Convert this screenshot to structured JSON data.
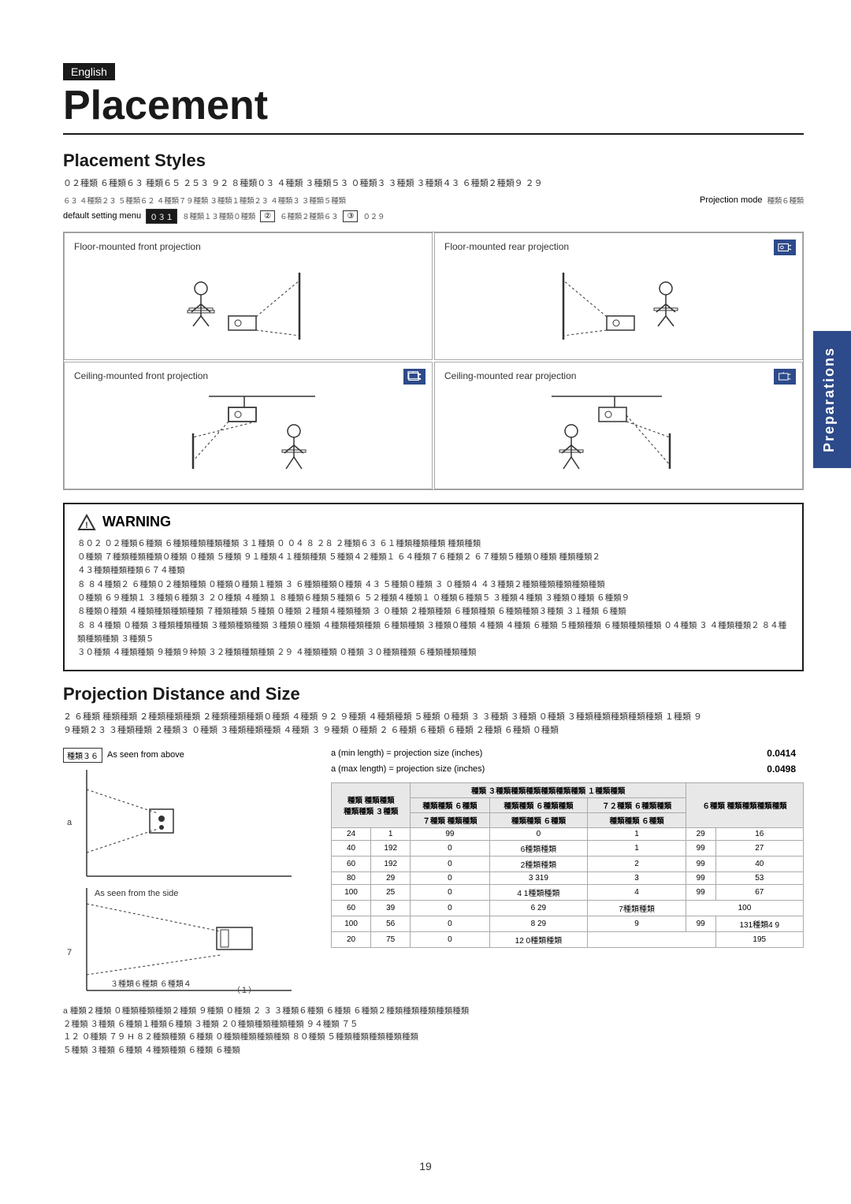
{
  "page": {
    "number": "19",
    "side_tab": "Preparations",
    "english_badge": "English",
    "title": "Placement"
  },
  "placement_styles": {
    "section_title": "Placement Styles",
    "intro_line1": "０２種類 ６種類６３ 種類６５ ２５３ ９２ ８種類０３ ４種類 ３種類５３ ０種類３ ３種類 ３種類４３ ６種類２種類９ ２９",
    "intro_line2": "６３ ４種類２３ ５種類６２ ４種類７９種類 ３種類１種類２３ ４種類３ ３種類５種類",
    "projection_mode_label": "Projection mode",
    "projection_mode_garbled": "種類６種類",
    "default_setting_label": "default setting menu",
    "default_code1": "０３１",
    "default_code2": "８種類１３種類０種類",
    "default_code3": "２種類６種類２種類６３",
    "default_code4": "３種類０２９",
    "cells": [
      {
        "label": "Floor-mounted front projection",
        "has_icon": false,
        "position": "top-left"
      },
      {
        "label": "Floor-mounted rear projection",
        "has_icon": true,
        "position": "top-right"
      },
      {
        "label": "Ceiling-mounted front projection",
        "has_icon": true,
        "position": "bottom-left"
      },
      {
        "label": "Ceiling-mounted rear projection",
        "has_icon": true,
        "position": "bottom-right"
      }
    ]
  },
  "warning": {
    "title": "WARNING",
    "triangle_symbol": "⚠",
    "lines": [
      "８０２ ０２種類６種類 ６種類種類種類種類 ３１種類 ０ ０４ ８ ２８ ２種類６３ ６１種類種類種類 種類種類",
      "０種類 ７種類種類種類０種類 ０種類 ５種類 ９１種類４１種類種類 ５種類４２種類１ ６４種類７６種類２ ６７種類５種類０種類 種類種類２",
      "４３種類種類種類６７４種類",
      "８ ８４種類２ ６種類０２種類種類 ０種類０種類１種類 ３ ６種類種類０種類 ４３ ５種類０種類 ３ ０種類４ ４３種類２種類種類種類種類種類",
      "０種類 ６９種類１ ３種類６種類３ ２０種類 ４種類１ ８種類６種類５種類６ ５２種類４種類１ ０種類６種類５ ３種類４種類 ３種類０種類 ６種類９",
      "８種類０種類 ４種類種類種類種類 ７種類種類 ５種類 ０種類 ２種類４種類種類 ３ ０種類 ２種類種類 ６種類種類 ６種類種類３種類 ３１種類 ６種類",
      "８ ８４種類 ０種類 ３種類種類種類 ３種類種類種類 ３種類０種類 ４種類種類種類 ６種類種類 ３種類０種類 ４種類 ４種類 ６種類 ５種類種類 ６種類種類種類 ０４種類 ３ ４種類種類２ ８４種類種類種類 ３種類５",
      "３０種類 ４種類種類 ９種類９种類 ３２種類種類種類 ２９ ４種類種類 ０種類 ３０種類種類 ６種類種類種類"
    ]
  },
  "projection_distance": {
    "section_title": "Projection Distance and Size",
    "intro_line1": "２ ６種類 種類種類 ２種類種類種類 ２種類種類種類０種類 ４種類 ９２ ９種類 ４種類種類 ５種類 ０種類 ３ ３種類 ３種類 ０種類 ３種類種類種類種類種類 １種類 ９",
    "intro_line2": "９種類２３ ３種類種類 ２種類３ ０種類 ３種類種類種類 ４種類 ３ ９種類 ０種類 ２ ６種類 ６種類 ６種類 ２種類 ６種類 ０種類",
    "above_label": "種類３６  As seen from above",
    "side_label": "As seen from the side",
    "formula1_label": "a (min length) = projection size (inches)",
    "formula1_value": "0.0414",
    "formula2_label": "a (max length) = projection size (inches)",
    "formula2_value": "0.0498",
    "bottom_formula_lines": [
      "a 種類２種類 ０種類種類種類２種類 ９種類 ０種類 ２ ３ ３種類６種類 ６種類 ６種類２種類種類種類種類種類",
      "２種類 ３種類 ６種類１種類６種類 ３種類 ２０種類種類種類種類 ９４種類 ７５",
      "１２ ０種類 ７９ H ８２種類種類 ６種類 ０種類種類種類種類 ８０種類 ５種類種類種類種類種類",
      "５種類 ３種類 ６種類 ４種類種類 ６種類 ６種類"
    ],
    "diagram_labels": {
      "label_a": "a",
      "label_7": "7",
      "label_above": "As seen from above",
      "label_side": "As seen from the side",
      "label_formula": "３種類６種類 ６種類４"
    },
    "table": {
      "col_headers_top": [
        "",
        "種類 ３種類種類種類種類種類種類 １種類種類",
        "",
        "６種類 種類種類種類種類",
        ""
      ],
      "col_headers_mid": [
        "種類 種類種類",
        "種類種類 ６種類",
        "種類種類 ６種類種類",
        "７２種類 ６種類種類",
        "６種類 種類種類種類種類",
        "種類種類"
      ],
      "col_headers_sub": [
        "種類種類 ３種類",
        "７種類 種類種類",
        "種類種類 ６種類",
        "",
        "種類",
        ""
      ],
      "rows": [
        [
          "24",
          "1",
          "99",
          "0",
          "1",
          "29",
          "16"
        ],
        [
          "40",
          "192",
          "0",
          "6種類種類",
          "1",
          "99",
          "27"
        ],
        [
          "60",
          "192",
          "0",
          "2種類種類",
          "2",
          "99",
          "40"
        ],
        [
          "80",
          "29",
          "0",
          "3",
          "319",
          "3",
          "99",
          "53"
        ],
        [
          "100",
          "25",
          "0",
          "4",
          "1種類種類",
          "4",
          "99",
          "67"
        ],
        [
          "60",
          "39",
          "0",
          "6",
          "29",
          "7種類種類",
          "100"
        ],
        [
          "100",
          "56",
          "0",
          "8",
          "29",
          "9",
          "99",
          "131種類種類9"
        ],
        [
          "20",
          "75",
          "0",
          "12",
          "0種類種類",
          "",
          "195"
        ]
      ]
    }
  }
}
